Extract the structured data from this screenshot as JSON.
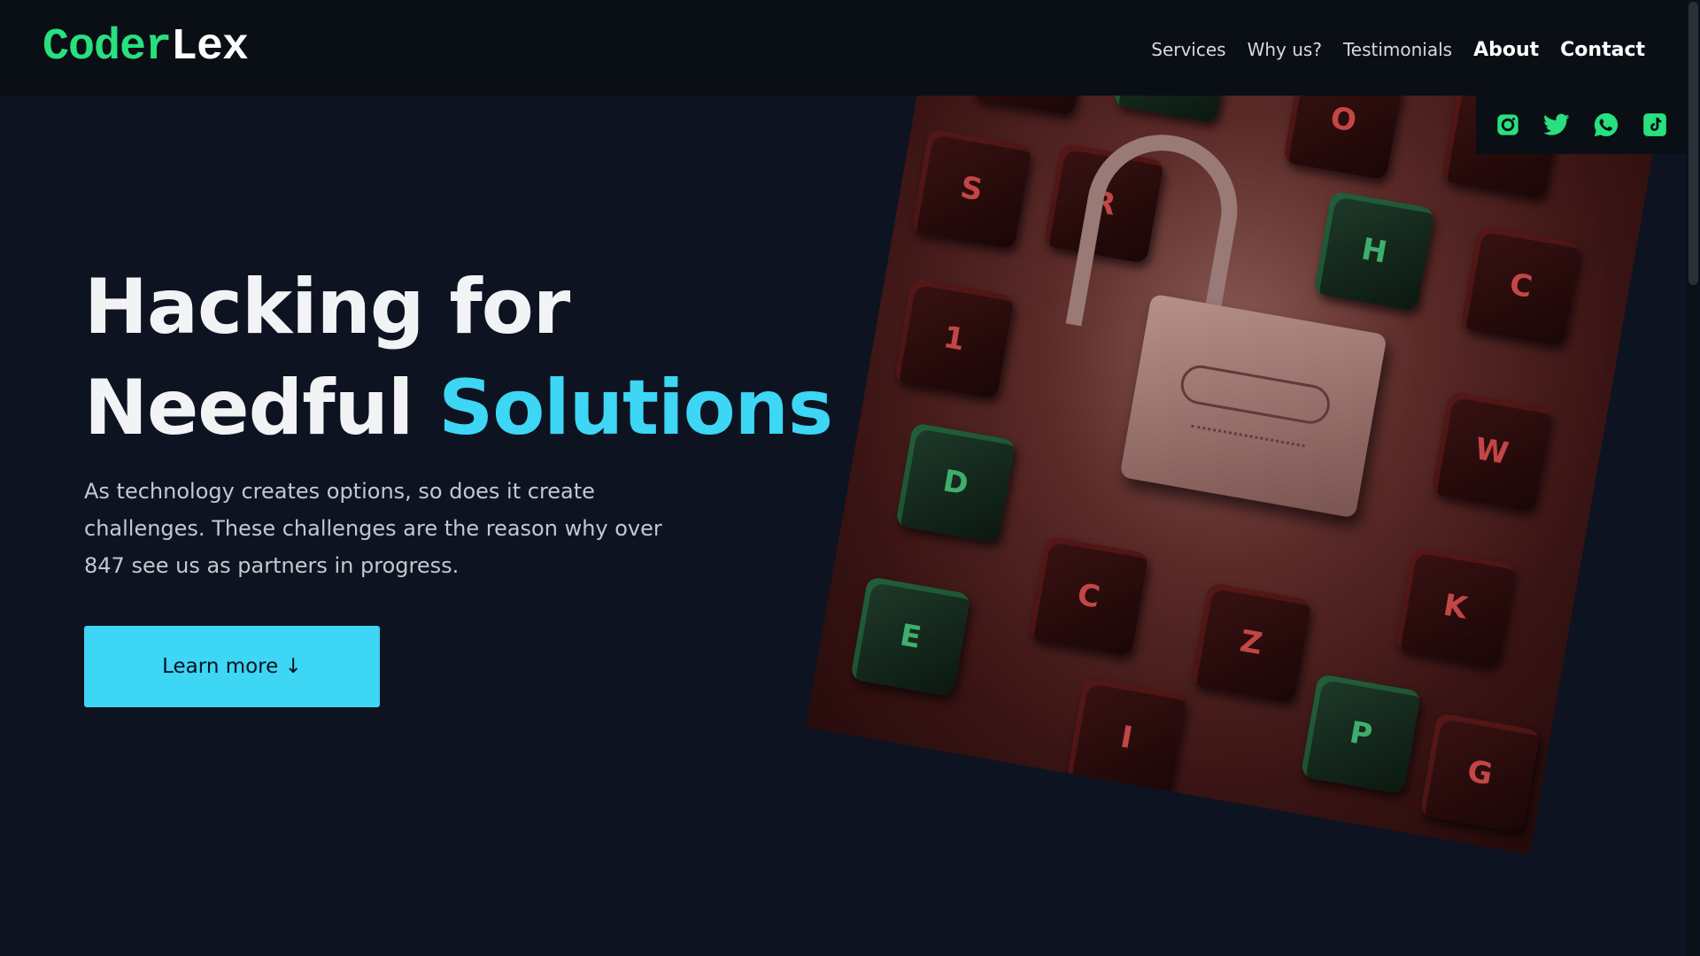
{
  "brand": {
    "logo_part1": "Coder",
    "logo_part2": "Lex"
  },
  "nav": {
    "items": [
      {
        "label": "Services"
      },
      {
        "label": "Why us?"
      },
      {
        "label": "Testimonials"
      },
      {
        "label": "About"
      },
      {
        "label": "Contact"
      }
    ]
  },
  "social": {
    "icons": [
      "instagram-icon",
      "twitter-icon",
      "whatsapp-icon",
      "tiktok-icon"
    ],
    "color": "#28e07e"
  },
  "hero": {
    "title_line1": "Hacking for",
    "title_line2_plain": "Needful ",
    "title_line2_accent": "Solutions",
    "description": "As technology creates options, so does it create challenges. These challenges are the reason why over 847 see us as partners in progress.",
    "cta_label": "Learn more ↓"
  },
  "colors": {
    "background": "#0d1320",
    "navbar": "#0a0e15",
    "accent_cyan": "#3dd6f5",
    "logo_green": "#28e07e"
  }
}
